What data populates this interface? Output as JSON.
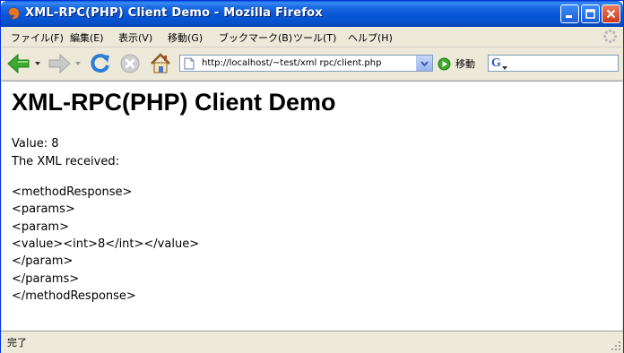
{
  "window": {
    "title": "XML-RPC(PHP) Client Demo - Mozilla Firefox"
  },
  "menu": {
    "items": [
      "ファイル(F)",
      "編集(E)",
      "表示(V)",
      "移動(G)",
      "ブックマーク(B)",
      "ツール(T)",
      "ヘルプ(H)"
    ]
  },
  "toolbar": {
    "url": "http://localhost/~test/xml rpc/client.php",
    "go_label": "移動",
    "search_engine_glyph": "G"
  },
  "page": {
    "heading": "XML-RPC(PHP) Client Demo",
    "value_text": "Value: 8",
    "xml_intro": "The XML received:",
    "xml_lines": [
      "<methodResponse>",
      "<params>",
      "<param>",
      "<value><int>8</int></value>",
      "</param>",
      "</params>",
      "</methodResponse>"
    ]
  },
  "status": {
    "text": "完了"
  },
  "colors": {
    "titlebar": "#0650CC",
    "close_button": "#C8391D",
    "back_arrow": "#3DAA2E",
    "go_button": "#3DAA2E"
  },
  "icons": [
    "firefox-icon",
    "minimize-icon",
    "maximize-icon",
    "close-icon",
    "back-arrow-icon",
    "forward-arrow-icon",
    "reload-icon",
    "stop-icon",
    "home-icon",
    "page-icon",
    "go-icon",
    "google-search-icon",
    "throbber-icon",
    "resize-grip-icon"
  ]
}
